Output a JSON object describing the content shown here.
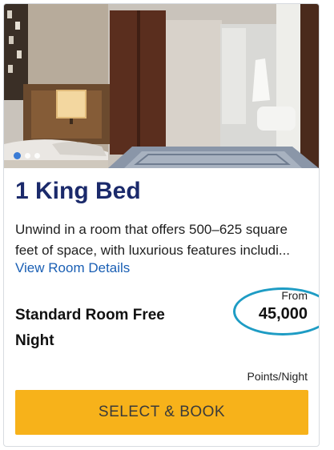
{
  "room": {
    "title": "1 King Bed",
    "description": "Unwind in a room that offers 500–625 square feet of space, with luxurious features includi...",
    "details_link": "View Room Details",
    "photo": {
      "subject": "hotel-room-photo",
      "carousel_total": 3,
      "carousel_active_index": 0
    }
  },
  "rate": {
    "name": "Standard Room Free Night",
    "from_label": "From",
    "price": "45,000",
    "unit_label": "Points/Night"
  },
  "actions": {
    "book_label": "SELECT & BOOK"
  },
  "colors": {
    "title": "#1b2a6b",
    "link": "#1a5fb4",
    "button": "#f7b21a",
    "highlight_ring": "#1e9cc4",
    "active_dot": "#3a7bd5"
  }
}
